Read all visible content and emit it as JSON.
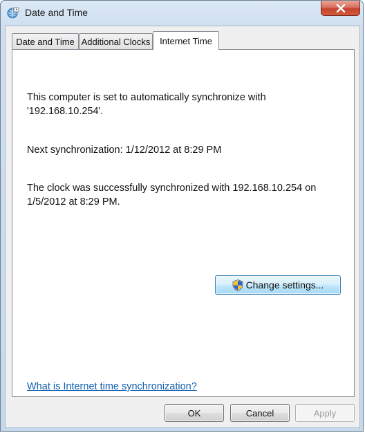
{
  "window": {
    "title": "Date and Time"
  },
  "tabs": [
    {
      "label": "Date and Time"
    },
    {
      "label": "Additional Clocks"
    },
    {
      "label": "Internet Time",
      "active": true
    }
  ],
  "panel": {
    "sync_line1": "This computer is set to automatically synchronize with",
    "sync_line2": "'192.168.10.254'.",
    "next_sync": "Next synchronization: 1/12/2012 at 8:29 PM",
    "last_sync_line1": "The clock was successfully synchronized with 192.168.10.254 on",
    "last_sync_line2": "1/5/2012 at 8:29 PM.",
    "change_settings_label": "Change settings...",
    "help_link": "What is Internet time synchronization?"
  },
  "buttons": {
    "ok": "OK",
    "cancel": "Cancel",
    "apply": "Apply"
  },
  "icons": {
    "title": "clock-globe-icon",
    "close": "close-icon",
    "shield": "uac-shield-icon"
  },
  "colors": {
    "link": "#0f5eb0",
    "close_button": "#c4432f",
    "frame": "#cfdff0"
  }
}
